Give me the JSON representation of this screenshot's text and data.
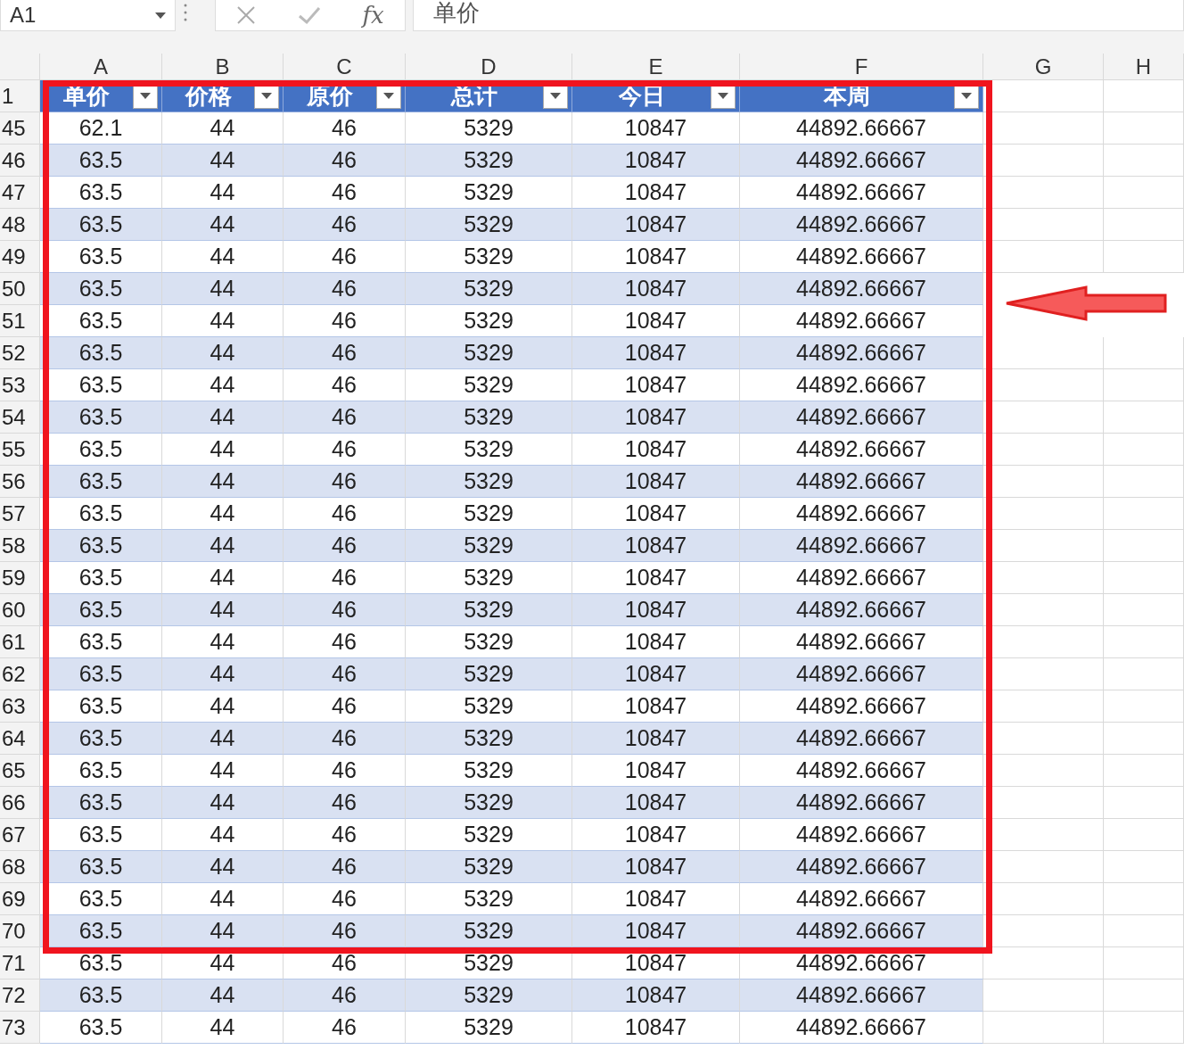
{
  "formula_bar": {
    "name_box": "A1",
    "function_button": "fx",
    "formula": "单价"
  },
  "column_headers": [
    "A",
    "B",
    "C",
    "D",
    "E",
    "F",
    "G",
    "H"
  ],
  "table": {
    "columns": [
      {
        "label": "单价"
      },
      {
        "label": "价格"
      },
      {
        "label": "原价"
      },
      {
        "label": "总计"
      },
      {
        "label": "今日"
      },
      {
        "label": "本周"
      }
    ],
    "header_row_number": "1",
    "rows": [
      {
        "row_number": "45",
        "cells": [
          "62.1",
          "44",
          "46",
          "5329",
          "10847",
          "44892.66667"
        ]
      },
      {
        "row_number": "46",
        "cells": [
          "63.5",
          "44",
          "46",
          "5329",
          "10847",
          "44892.66667"
        ]
      },
      {
        "row_number": "47",
        "cells": [
          "63.5",
          "44",
          "46",
          "5329",
          "10847",
          "44892.66667"
        ]
      },
      {
        "row_number": "48",
        "cells": [
          "63.5",
          "44",
          "46",
          "5329",
          "10847",
          "44892.66667"
        ]
      },
      {
        "row_number": "49",
        "cells": [
          "63.5",
          "44",
          "46",
          "5329",
          "10847",
          "44892.66667"
        ]
      },
      {
        "row_number": "50",
        "cells": [
          "63.5",
          "44",
          "46",
          "5329",
          "10847",
          "44892.66667"
        ]
      },
      {
        "row_number": "51",
        "cells": [
          "63.5",
          "44",
          "46",
          "5329",
          "10847",
          "44892.66667"
        ]
      },
      {
        "row_number": "52",
        "cells": [
          "63.5",
          "44",
          "46",
          "5329",
          "10847",
          "44892.66667"
        ]
      },
      {
        "row_number": "53",
        "cells": [
          "63.5",
          "44",
          "46",
          "5329",
          "10847",
          "44892.66667"
        ]
      },
      {
        "row_number": "54",
        "cells": [
          "63.5",
          "44",
          "46",
          "5329",
          "10847",
          "44892.66667"
        ]
      },
      {
        "row_number": "55",
        "cells": [
          "63.5",
          "44",
          "46",
          "5329",
          "10847",
          "44892.66667"
        ]
      },
      {
        "row_number": "56",
        "cells": [
          "63.5",
          "44",
          "46",
          "5329",
          "10847",
          "44892.66667"
        ]
      },
      {
        "row_number": "57",
        "cells": [
          "63.5",
          "44",
          "46",
          "5329",
          "10847",
          "44892.66667"
        ]
      },
      {
        "row_number": "58",
        "cells": [
          "63.5",
          "44",
          "46",
          "5329",
          "10847",
          "44892.66667"
        ]
      },
      {
        "row_number": "59",
        "cells": [
          "63.5",
          "44",
          "46",
          "5329",
          "10847",
          "44892.66667"
        ]
      },
      {
        "row_number": "60",
        "cells": [
          "63.5",
          "44",
          "46",
          "5329",
          "10847",
          "44892.66667"
        ]
      },
      {
        "row_number": "61",
        "cells": [
          "63.5",
          "44",
          "46",
          "5329",
          "10847",
          "44892.66667"
        ]
      },
      {
        "row_number": "62",
        "cells": [
          "63.5",
          "44",
          "46",
          "5329",
          "10847",
          "44892.66667"
        ]
      },
      {
        "row_number": "63",
        "cells": [
          "63.5",
          "44",
          "46",
          "5329",
          "10847",
          "44892.66667"
        ]
      },
      {
        "row_number": "64",
        "cells": [
          "63.5",
          "44",
          "46",
          "5329",
          "10847",
          "44892.66667"
        ]
      },
      {
        "row_number": "65",
        "cells": [
          "63.5",
          "44",
          "46",
          "5329",
          "10847",
          "44892.66667"
        ]
      },
      {
        "row_number": "66",
        "cells": [
          "63.5",
          "44",
          "46",
          "5329",
          "10847",
          "44892.66667"
        ]
      },
      {
        "row_number": "67",
        "cells": [
          "63.5",
          "44",
          "46",
          "5329",
          "10847",
          "44892.66667"
        ]
      },
      {
        "row_number": "68",
        "cells": [
          "63.5",
          "44",
          "46",
          "5329",
          "10847",
          "44892.66667"
        ]
      },
      {
        "row_number": "69",
        "cells": [
          "63.5",
          "44",
          "46",
          "5329",
          "10847",
          "44892.66667"
        ]
      },
      {
        "row_number": "70",
        "cells": [
          "63.5",
          "44",
          "46",
          "5329",
          "10847",
          "44892.66667"
        ]
      },
      {
        "row_number": "71",
        "cells": [
          "63.5",
          "44",
          "46",
          "5329",
          "10847",
          "44892.66667"
        ]
      },
      {
        "row_number": "72",
        "cells": [
          "63.5",
          "44",
          "46",
          "5329",
          "10847",
          "44892.66667"
        ]
      },
      {
        "row_number": "73",
        "cells": [
          "63.5",
          "44",
          "46",
          "5329",
          "10847",
          "44892.66667"
        ]
      }
    ]
  }
}
